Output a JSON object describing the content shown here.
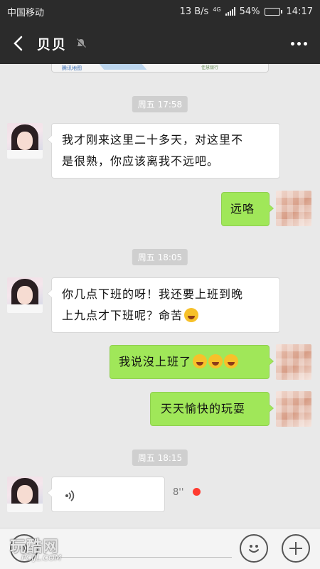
{
  "status_bar": {
    "carrier": "中国移动",
    "speed": "13 B/s",
    "network": "4G",
    "battery": "54%",
    "battery_level": 0.54,
    "time": "14:17"
  },
  "header": {
    "title": "贝贝",
    "back_icon": "back-chevron-icon",
    "mute_icon": "bell-muted-icon",
    "more_icon": "more-dots-icon"
  },
  "map": {
    "logo": "腾讯地图",
    "tag": "佳慧银行"
  },
  "messages": [
    {
      "type": "time",
      "text": "周五 17:58"
    },
    {
      "type": "text",
      "from": "friend",
      "text_lines": [
        "我才刚来这里二十多天，对这里不",
        "是很熟，你应该离我不远吧。"
      ]
    },
    {
      "type": "text",
      "from": "me",
      "text": "远咯"
    },
    {
      "type": "time",
      "text": "周五 18:05"
    },
    {
      "type": "text",
      "from": "friend",
      "text_lines": [
        "你几点下班的呀！我还要上班到晚",
        "上九点才下班呢？命苦"
      ],
      "emoji": "tired-face-emoji"
    },
    {
      "type": "text",
      "from": "me",
      "text": "我说沒上班了",
      "emoji": "laughing-emoji"
    },
    {
      "type": "text",
      "from": "me",
      "text": "天天愉快的玩耍"
    },
    {
      "type": "time",
      "text": "周五 18:15"
    },
    {
      "type": "voice",
      "from": "friend",
      "duration": "8''",
      "unread": true
    }
  ],
  "bottom_bar": {
    "voice_toggle_icon": "voice-mode-icon",
    "emoji_icon": "smiley-icon",
    "add_icon": "plus-icon"
  },
  "watermark": {
    "text": "玩酷网",
    "sub": "PCIJL.COM"
  },
  "colors": {
    "header_bg": "#2b2b2b",
    "chat_bg": "#e9e9e9",
    "sent_bubble": "#a0e759",
    "received_bubble": "#ffffff",
    "unread_dot": "#ff3b30"
  }
}
